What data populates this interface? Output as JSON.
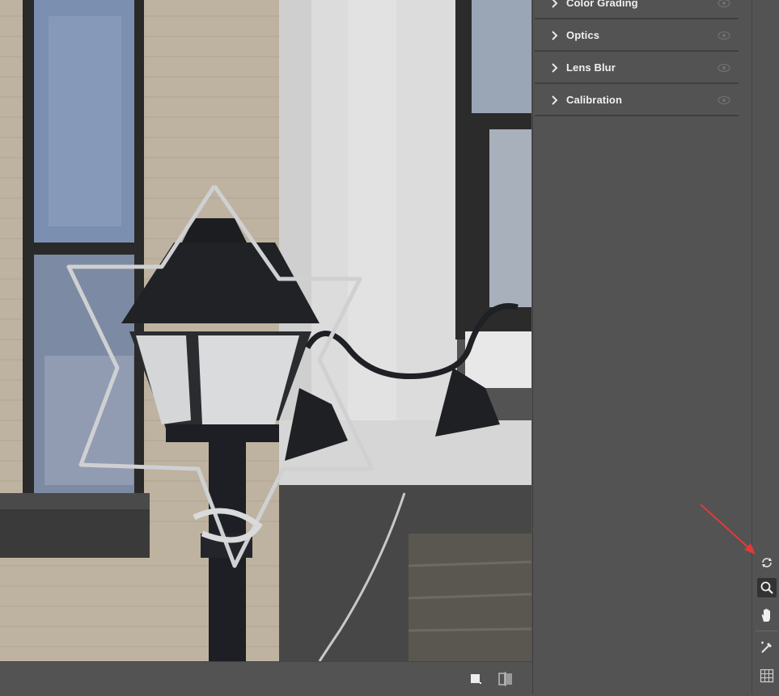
{
  "panel": {
    "sections": [
      {
        "label": "Color Grading",
        "icon": "chevron-right-icon",
        "visibility_icon": "eye-icon"
      },
      {
        "label": "Optics",
        "icon": "chevron-right-icon",
        "visibility_icon": "eye-icon"
      },
      {
        "label": "Lens Blur",
        "icon": "chevron-right-icon",
        "visibility_icon": "eye-icon"
      },
      {
        "label": "Calibration",
        "icon": "chevron-right-icon",
        "visibility_icon": "eye-icon"
      }
    ]
  },
  "toolstrip": {
    "tools": [
      {
        "name": "rotate-icon",
        "active": false
      },
      {
        "name": "zoom-icon",
        "active": true
      },
      {
        "name": "hand-icon",
        "active": false
      },
      {
        "name": "eyedropper-icon",
        "active": false
      },
      {
        "name": "grid-icon",
        "active": false
      }
    ]
  },
  "bottom_bar": {
    "icons": [
      "view-single-icon",
      "compare-icon"
    ]
  },
  "annotation": {
    "color": "#e03a3a"
  },
  "colors": {
    "panel_bg": "#535353",
    "divider": "#3f3f3f",
    "label_text": "#f0f0f0",
    "active_tool_bg": "#323232"
  }
}
